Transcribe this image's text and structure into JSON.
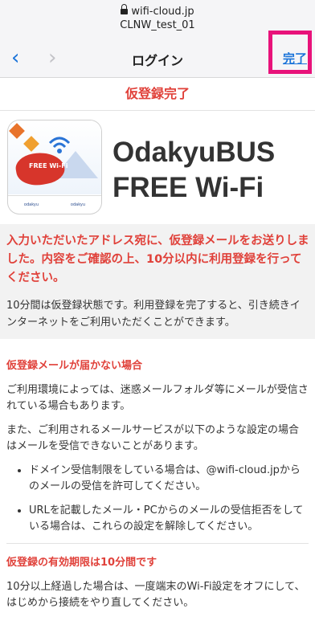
{
  "browser": {
    "domain": "wifi-cloud.jp",
    "ssid": "CLNW_test_01",
    "nav_title": "ログイン",
    "done_label": "完了",
    "back_glyph": "‹",
    "forward_glyph": "›"
  },
  "page": {
    "title": "仮登録完了",
    "brand_line1": "OdakyuBUS",
    "brand_line2": "FREE Wi-Fi",
    "logo_text": "FREE Wi-Fi",
    "logo_footer_left": "odakyu",
    "logo_footer_right": "odakyu",
    "notice_red": "入力いただいたアドレス宛に、仮登録メールをお送りしました。内容をご確認の上、10分以内に利用登録を行ってください。",
    "notice_gray": "10分間は仮登録状態です。利用登録を完了すると、引き続きインターネットをご利用いただくことができます。",
    "section1_heading": "仮登録メールが届かない場合",
    "section1_p1": "ご利用環境によっては、迷惑メールフォルダ等にメールが受信されている場合もあります。",
    "section1_p2": "また、ご利用されるメールサービスが以下のような設定の場合はメールを受信できないことがあります。",
    "bullets": [
      "ドメイン受信制限をしている場合は、@wifi-cloud.jpからのメールの受信を許可してください。",
      "URLを記載したメール・PCからのメールの受信拒否をしている場合は、これらの設定を解除してください。"
    ],
    "section2_heading": "仮登録の有効期限は10分間です",
    "section2_p": "10分以上経過した場合は、一度端末のWi-Fi設定をオフにして、はじめから接続をやり直してください。"
  },
  "colors": {
    "accent_red": "#e0413a",
    "link_blue": "#1a73d9",
    "highlight_pink": "#e8127a"
  }
}
